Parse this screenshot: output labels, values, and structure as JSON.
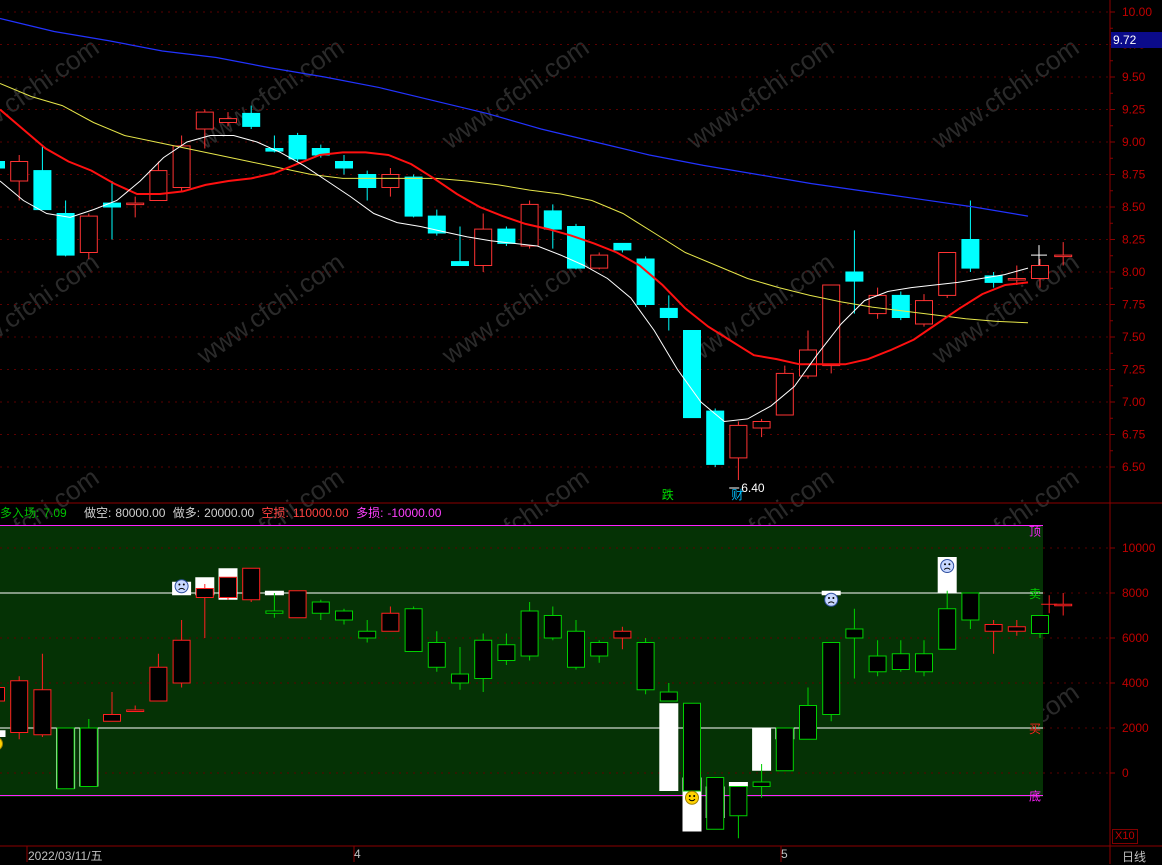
{
  "colors": {
    "up": "#ff3333",
    "down": "#00ffff",
    "ma_white": "#ffffff",
    "ma_red": "#ff1010",
    "ma_yellow": "#e6e64a",
    "ma_blue": "#2233ff",
    "panel_bg": "#053205",
    "axis": "#8b0000"
  },
  "chart_data": [
    {
      "type": "candlestick",
      "ylim": [
        6.3,
        10.1
      ],
      "y_ticks": [
        "10.00",
        "9.75",
        "9.50",
        "9.25",
        "9.00",
        "8.75",
        "8.50",
        "8.25",
        "8.00",
        "7.75",
        "7.50",
        "7.25",
        "7.00",
        "6.75",
        "6.50"
      ],
      "current_price": "9.72",
      "candles": [
        {
          "o": 8.85,
          "h": 8.95,
          "l": 8.75,
          "c": 8.8
        },
        {
          "o": 8.7,
          "h": 8.9,
          "l": 8.55,
          "c": 8.85
        },
        {
          "o": 8.78,
          "h": 8.97,
          "l": 8.48,
          "c": 8.48
        },
        {
          "o": 8.45,
          "h": 8.55,
          "l": 8.12,
          "c": 8.13
        },
        {
          "o": 8.15,
          "h": 8.45,
          "l": 8.1,
          "c": 8.43
        },
        {
          "o": 8.53,
          "h": 8.7,
          "l": 8.25,
          "c": 8.5
        },
        {
          "o": 8.53,
          "h": 8.58,
          "l": 8.42,
          "c": 8.53
        },
        {
          "o": 8.55,
          "h": 8.85,
          "l": 8.55,
          "c": 8.78
        },
        {
          "o": 8.65,
          "h": 9.05,
          "l": 8.62,
          "c": 8.97
        },
        {
          "o": 9.1,
          "h": 9.25,
          "l": 8.95,
          "c": 9.23
        },
        {
          "o": 9.15,
          "h": 9.23,
          "l": 9.12,
          "c": 9.18
        },
        {
          "o": 9.22,
          "h": 9.28,
          "l": 9.1,
          "c": 9.12
        },
        {
          "o": 8.95,
          "h": 9.05,
          "l": 8.92,
          "c": 8.93
        },
        {
          "o": 9.05,
          "h": 9.07,
          "l": 8.85,
          "c": 8.87
        },
        {
          "o": 8.95,
          "h": 8.98,
          "l": 8.88,
          "c": 8.9
        },
        {
          "o": 8.85,
          "h": 8.9,
          "l": 8.75,
          "c": 8.8
        },
        {
          "o": 8.75,
          "h": 8.78,
          "l": 8.55,
          "c": 8.65
        },
        {
          "o": 8.65,
          "h": 8.8,
          "l": 8.58,
          "c": 8.75
        },
        {
          "o": 8.73,
          "h": 8.75,
          "l": 8.42,
          "c": 8.43
        },
        {
          "o": 8.43,
          "h": 8.48,
          "l": 8.28,
          "c": 8.3
        },
        {
          "o": 8.08,
          "h": 8.35,
          "l": 8.05,
          "c": 8.05
        },
        {
          "o": 8.05,
          "h": 8.45,
          "l": 8.0,
          "c": 8.33
        },
        {
          "o": 8.33,
          "h": 8.35,
          "l": 8.2,
          "c": 8.22
        },
        {
          "o": 8.2,
          "h": 8.55,
          "l": 8.18,
          "c": 8.52
        },
        {
          "o": 8.47,
          "h": 8.52,
          "l": 8.18,
          "c": 8.33
        },
        {
          "o": 8.35,
          "h": 8.37,
          "l": 8.02,
          "c": 8.03
        },
        {
          "o": 8.03,
          "h": 8.15,
          "l": 8.02,
          "c": 8.13
        },
        {
          "o": 8.22,
          "h": 8.22,
          "l": 8.15,
          "c": 8.17
        },
        {
          "o": 8.1,
          "h": 8.12,
          "l": 7.73,
          "c": 7.75
        },
        {
          "o": 7.72,
          "h": 7.82,
          "l": 7.55,
          "c": 7.65
        },
        {
          "o": 7.55,
          "h": 7.55,
          "l": 6.88,
          "c": 6.88
        },
        {
          "o": 6.93,
          "h": 6.95,
          "l": 6.5,
          "c": 6.52
        },
        {
          "o": 6.57,
          "h": 6.85,
          "l": 6.4,
          "c": 6.82
        },
        {
          "o": 6.8,
          "h": 6.87,
          "l": 6.73,
          "c": 6.85
        },
        {
          "o": 6.9,
          "h": 7.28,
          "l": 6.9,
          "c": 7.22
        },
        {
          "o": 7.2,
          "h": 7.55,
          "l": 7.18,
          "c": 7.4
        },
        {
          "o": 7.28,
          "h": 7.9,
          "l": 7.22,
          "c": 7.9
        },
        {
          "o": 8.0,
          "h": 8.32,
          "l": 7.68,
          "c": 7.93
        },
        {
          "o": 7.68,
          "h": 7.88,
          "l": 7.64,
          "c": 7.82
        },
        {
          "o": 7.82,
          "h": 7.85,
          "l": 7.63,
          "c": 7.65
        },
        {
          "o": 7.6,
          "h": 7.83,
          "l": 7.58,
          "c": 7.78
        },
        {
          "o": 7.82,
          "h": 8.15,
          "l": 7.8,
          "c": 8.15
        },
        {
          "o": 8.25,
          "h": 8.55,
          "l": 8.0,
          "c": 8.03
        },
        {
          "o": 7.97,
          "h": 8.0,
          "l": 7.88,
          "c": 7.92
        },
        {
          "o": 7.95,
          "h": 8.05,
          "l": 7.9,
          "c": 7.95
        },
        {
          "o": 7.95,
          "h": 8.1,
          "l": 7.88,
          "c": 8.05
        },
        {
          "o": 8.13,
          "h": 8.23,
          "l": 8.05,
          "c": 8.13
        }
      ],
      "ma_white": [
        8.7,
        8.55,
        8.45,
        8.42,
        8.48,
        8.55,
        8.7,
        8.88,
        9.0,
        9.05,
        9.05,
        9.0,
        8.92,
        8.82,
        8.7,
        8.58,
        8.45,
        8.38,
        8.35,
        8.31,
        8.27,
        8.24,
        8.22,
        8.2,
        8.13,
        8.05,
        7.95,
        7.8,
        7.55,
        7.25,
        7.0,
        6.85,
        6.87,
        6.97,
        7.12,
        7.37,
        7.6,
        7.78,
        7.85,
        7.88,
        7.9,
        7.92,
        7.95,
        7.98,
        8.03
      ],
      "ma_red": [
        9.25,
        9.1,
        8.95,
        8.85,
        8.78,
        8.68,
        8.6,
        8.6,
        8.62,
        8.67,
        8.7,
        8.72,
        8.76,
        8.83,
        8.9,
        8.92,
        8.92,
        8.9,
        8.83,
        8.72,
        8.6,
        8.5,
        8.43,
        8.37,
        8.33,
        8.28,
        8.22,
        8.15,
        8.05,
        7.9,
        7.72,
        7.58,
        7.47,
        7.36,
        7.33,
        7.29,
        7.29,
        7.29,
        7.33,
        7.4,
        7.48,
        7.6,
        7.72,
        7.83,
        7.9,
        7.92
      ],
      "ma_yellow": [
        9.45,
        9.35,
        9.28,
        9.15,
        9.05,
        9.0,
        8.95,
        8.9,
        8.85,
        8.8,
        8.75,
        8.72,
        8.72,
        8.72,
        8.72,
        8.7,
        8.67,
        8.63,
        8.6,
        8.55,
        8.45,
        8.3,
        8.15,
        8.05,
        7.95,
        7.88,
        7.82,
        7.77,
        7.73,
        7.7,
        7.67,
        7.64,
        7.62,
        7.61
      ],
      "ma_blue": [
        9.95,
        9.85,
        9.78,
        9.7,
        9.65,
        9.57,
        9.5,
        9.42,
        9.32,
        9.22,
        9.1,
        9.0,
        8.9,
        8.82,
        8.75,
        8.68,
        8.62,
        8.56,
        8.5,
        8.43
      ],
      "annotations": [
        "6.40"
      ],
      "markers": [
        "跌",
        "财"
      ]
    },
    {
      "type": "candlestick",
      "ylim": [
        -3200,
        11500
      ],
      "y_ticks": [
        "10000",
        "8000",
        "6000",
        "4000",
        "2000",
        "0"
      ],
      "levels": {
        "top": 11000,
        "sell": 8000,
        "buy": 2000,
        "bottom": -1000
      },
      "level_labels": {
        "top": "顶",
        "sell": "卖",
        "buy": "买",
        "bottom": "底"
      },
      "scale_badge": "X10",
      "candles": [
        {
          "o": 3200,
          "h": 3800,
          "l": 2500,
          "c": 3800
        },
        {
          "o": 1800,
          "h": 4300,
          "l": 1500,
          "c": 4100
        },
        {
          "o": 1700,
          "h": 5300,
          "l": 1600,
          "c": 3700
        },
        {
          "o": 2000,
          "h": 2000,
          "l": -700,
          "c": -700
        },
        {
          "o": 2000,
          "h": 2400,
          "l": -600,
          "c": -600
        },
        {
          "o": 2300,
          "h": 3600,
          "l": 2300,
          "c": 2600
        },
        {
          "o": 2800,
          "h": 3000,
          "l": 2800,
          "c": 2800
        },
        {
          "o": 3200,
          "h": 5300,
          "l": 3200,
          "c": 4700
        },
        {
          "o": 4000,
          "h": 6800,
          "l": 3800,
          "c": 5900
        },
        {
          "o": 7800,
          "h": 8400,
          "l": 6000,
          "c": 8200
        },
        {
          "o": 7800,
          "h": 8700,
          "l": 7700,
          "c": 8700
        },
        {
          "o": 7700,
          "h": 9100,
          "l": 7600,
          "c": 9100
        },
        {
          "o": 7200,
          "h": 8000,
          "l": 6900,
          "c": 7100
        },
        {
          "o": 6900,
          "h": 8100,
          "l": 6900,
          "c": 8100
        },
        {
          "o": 7600,
          "h": 7700,
          "l": 6800,
          "c": 7100
        },
        {
          "o": 7200,
          "h": 7300,
          "l": 6600,
          "c": 6800
        },
        {
          "o": 6300,
          "h": 6800,
          "l": 5800,
          "c": 6000
        },
        {
          "o": 6300,
          "h": 7400,
          "l": 6300,
          "c": 7100
        },
        {
          "o": 7300,
          "h": 7400,
          "l": 5400,
          "c": 5400
        },
        {
          "o": 5800,
          "h": 6300,
          "l": 4500,
          "c": 4700
        },
        {
          "o": 4400,
          "h": 5600,
          "l": 3700,
          "c": 4000
        },
        {
          "o": 5900,
          "h": 6200,
          "l": 3600,
          "c": 4200
        },
        {
          "o": 5700,
          "h": 6200,
          "l": 4800,
          "c": 5000
        },
        {
          "o": 7200,
          "h": 7600,
          "l": 5000,
          "c": 5200
        },
        {
          "o": 7000,
          "h": 7400,
          "l": 5900,
          "c": 6000
        },
        {
          "o": 6300,
          "h": 6800,
          "l": 4600,
          "c": 4700
        },
        {
          "o": 5800,
          "h": 5900,
          "l": 4900,
          "c": 5200
        },
        {
          "o": 6000,
          "h": 6500,
          "l": 5500,
          "c": 6300
        },
        {
          "o": 5800,
          "h": 6000,
          "l": 3500,
          "c": 3700
        },
        {
          "o": 3600,
          "h": 4000,
          "l": 3500,
          "c": 3200
        },
        {
          "o": 3100,
          "h": 3100,
          "l": -800,
          "c": -800
        },
        {
          "o": -200,
          "h": -200,
          "l": -2500,
          "c": -2500
        },
        {
          "o": -600,
          "h": -600,
          "l": -2900,
          "c": -1900
        },
        {
          "o": -400,
          "h": 400,
          "l": -1100,
          "c": -600
        },
        {
          "o": 2000,
          "h": 2000,
          "l": 100,
          "c": 100
        },
        {
          "o": 3000,
          "h": 3800,
          "l": 1500,
          "c": 1500
        },
        {
          "o": 5800,
          "h": 5800,
          "l": 2300,
          "c": 2600
        },
        {
          "o": 6400,
          "h": 7300,
          "l": 4200,
          "c": 6000
        },
        {
          "o": 5200,
          "h": 5900,
          "l": 4300,
          "c": 4500
        },
        {
          "o": 5300,
          "h": 5900,
          "l": 4500,
          "c": 4600
        },
        {
          "o": 5300,
          "h": 5900,
          "l": 4300,
          "c": 4500
        },
        {
          "o": 7300,
          "h": 8100,
          "l": 5500,
          "c": 5500
        },
        {
          "o": 8000,
          "h": 8000,
          "l": 6400,
          "c": 6800
        },
        {
          "o": 6300,
          "h": 6800,
          "l": 5300,
          "c": 6600
        },
        {
          "o": 6300,
          "h": 6800,
          "l": 6100,
          "c": 6500
        },
        {
          "o": 7000,
          "h": 7000,
          "l": 6000,
          "c": 6200
        },
        {
          "o": 7500,
          "h": 8000,
          "l": 7000,
          "c": 7500
        }
      ],
      "ma_white_bars": [
        {
          "i": 0,
          "top": 1900,
          "bot": 1600
        },
        {
          "i": 3,
          "top": 2000,
          "bot": -700
        },
        {
          "i": 4,
          "top": 2000,
          "bot": -600
        },
        {
          "i": 8,
          "top": 8500,
          "bot": 7900
        },
        {
          "i": 9,
          "top": 8700,
          "bot": 7900
        },
        {
          "i": 10,
          "top": 9100,
          "bot": 7700
        },
        {
          "i": 12,
          "top": 8100,
          "bot": 7900
        },
        {
          "i": 29,
          "top": 3100,
          "bot": -800
        },
        {
          "i": 30,
          "top": -200,
          "bot": -2600
        },
        {
          "i": 31,
          "top": -600,
          "bot": -2000
        },
        {
          "i": 32,
          "top": -400,
          "bot": -600
        },
        {
          "i": 33,
          "top": 2000,
          "bot": 100
        },
        {
          "i": 34,
          "top": 2000,
          "bot": 1500
        },
        {
          "i": 36,
          "top": 8100,
          "bot": 7900
        },
        {
          "i": 41,
          "top": 9600,
          "bot": 8000
        }
      ],
      "smileys": [
        {
          "i": 0,
          "v": 1300,
          "kind": "happy"
        },
        {
          "i": 8,
          "v": 8300,
          "kind": "sad"
        },
        {
          "i": 30,
          "v": -1100,
          "kind": "happy"
        },
        {
          "i": 36,
          "v": 7700,
          "kind": "sad"
        },
        {
          "i": 41,
          "v": 9200,
          "kind": "sad"
        }
      ]
    }
  ],
  "info_bar": {
    "long_entry_label": "多入场:",
    "long_entry_value": "7.09",
    "short_label": "做空:",
    "short_value": "80000.00",
    "long_label": "做多:",
    "long_value": "20000.00",
    "short_loss_label": "空损:",
    "short_loss_value": "110000.00",
    "long_loss_label": "多损:",
    "long_loss_value": "-10000.00"
  },
  "dates": {
    "start": "2022/03/11/五",
    "month_4": "4",
    "month_5": "5"
  },
  "period_label": "日线",
  "watermark": "www.cfchi.com"
}
